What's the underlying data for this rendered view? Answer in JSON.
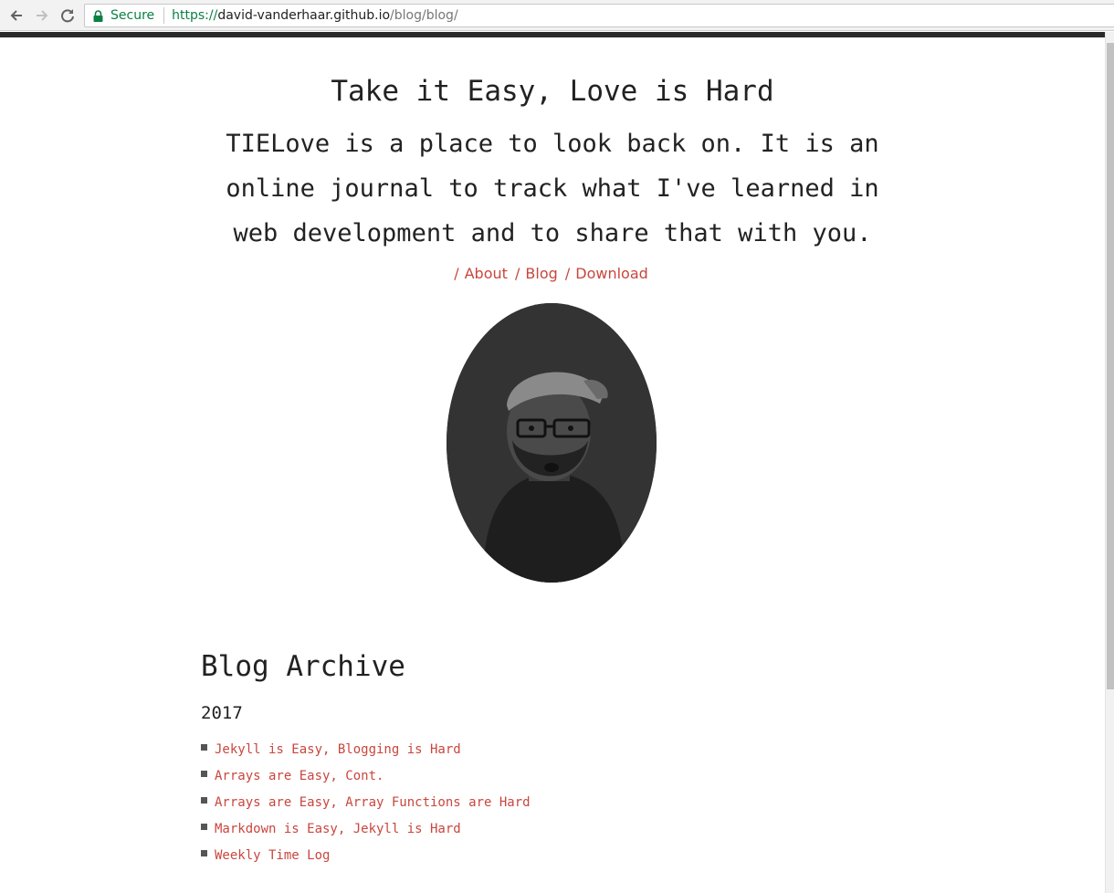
{
  "browser": {
    "secure_label": "Secure",
    "url_scheme": "https://",
    "url_host": "david-vanderhaar.github.io",
    "url_path": "/blog/blog/"
  },
  "header": {
    "title": "Take it Easy, Love is Hard",
    "tagline": "TIELove is a place to look back on. It is an online journal to track what I've learned in web development and to share that with you."
  },
  "nav": {
    "items": [
      {
        "label": "About"
      },
      {
        "label": "Blog"
      },
      {
        "label": "Download"
      }
    ]
  },
  "archive": {
    "title": "Blog Archive",
    "year": "2017",
    "posts": [
      {
        "title": "Jekyll is Easy, Blogging is Hard"
      },
      {
        "title": "Arrays are Easy, Cont."
      },
      {
        "title": "Arrays are Easy, Array Functions are Hard"
      },
      {
        "title": "Markdown is Easy, Jekyll is Hard"
      },
      {
        "title": "Weekly Time Log"
      }
    ]
  },
  "colors": {
    "accent": "#c9463d",
    "text": "#222222",
    "topbar": "#2a2a2a"
  }
}
